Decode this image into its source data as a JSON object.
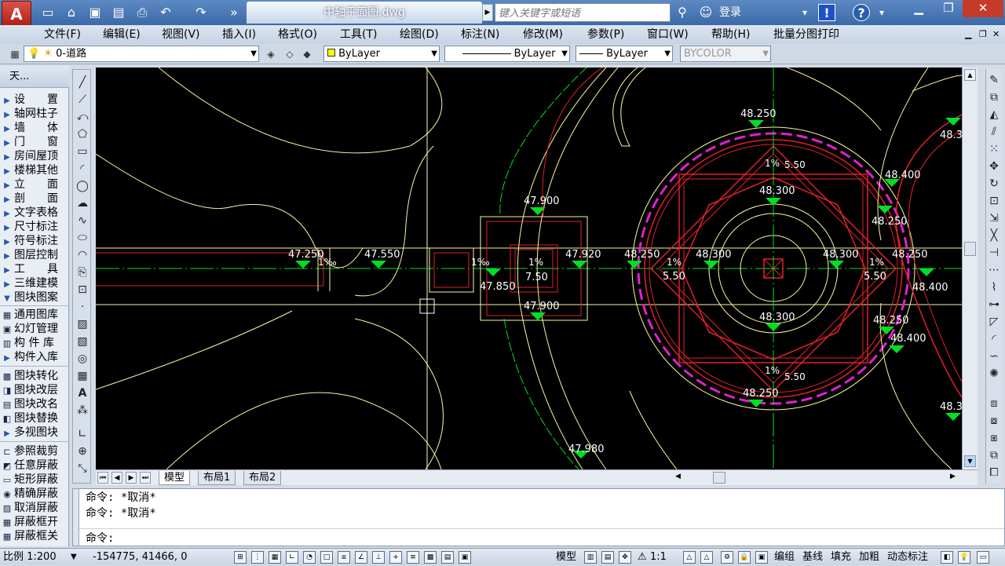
{
  "titlebar": {
    "app_button_label": "A",
    "document_title": "中轴平面图.dwg",
    "search_placeholder": "键入关键字或短语",
    "login_label": "登录"
  },
  "menu": {
    "items": [
      "文件(F)",
      "编辑(E)",
      "视图(V)",
      "插入(I)",
      "格式(O)",
      "工具(T)",
      "绘图(D)",
      "标注(N)",
      "修改(M)",
      "参数(P)",
      "窗口(W)",
      "帮助(H)",
      "批量分图打印"
    ]
  },
  "toolbar": {
    "layer_value": "0-道路",
    "color_value": "ByLayer",
    "linetype_value": "ByLayer",
    "lineweight_value": "ByLayer",
    "plotstyle_value": "BYCOLOR"
  },
  "left_panel": {
    "header": "天...",
    "items": [
      "设　　置",
      "轴网柱子",
      "墙　　体",
      "门　　窗",
      "房间屋顶",
      "楼梯其他",
      "立　　面",
      "剖　　面",
      "文字表格",
      "尺寸标注",
      "符号标注",
      "图层控制",
      "工　　具",
      "三维建模",
      "图块图案"
    ],
    "lib_items": [
      "通用图库",
      "幻灯管理",
      "构 件 库",
      "构件入库"
    ],
    "block_items": [
      "图块转化",
      "图块改层",
      "图块改名",
      "图块替换",
      "多视图块"
    ],
    "mask_items": [
      "参照裁剪",
      "任意屏蔽",
      "矩形屏蔽",
      "精确屏蔽",
      "取消屏蔽",
      "屏蔽框开",
      "屏蔽框关"
    ]
  },
  "drawing": {
    "elevations": {
      "e47250": "47.250",
      "e47550": "47.550",
      "e47900_top": "47.900",
      "e47920": "47.920",
      "e47850": "47.850",
      "e47900_bot": "47.900",
      "e47980": "47.980",
      "e48250_left": "48.250",
      "e48300_left": "48.300",
      "e48300_top": "48.300",
      "e48300_right": "48.300",
      "e48300_bot": "48.300",
      "e48250_top": "48.250",
      "e48250_bot": "48.250",
      "e48400_tr": "48.400",
      "e48250_tr2": "48.250",
      "e48250_right": "48.250",
      "e48400_right": "48.400",
      "e48250_br": "48.250",
      "e48400_br": "48.400",
      "e483_edge1": "48.3",
      "e483_edge2": "48.3"
    },
    "slopes": {
      "s_left1": "1‰",
      "s_left2": "1‰",
      "s_center": "1%",
      "s_left_circle": "1%",
      "s_right_circle": "1%",
      "s_vert_top": "1%",
      "s_vert_bot": "1%"
    },
    "dims": {
      "d750": "7.50",
      "d550_left": "5.50",
      "d550_right": "5.50",
      "d550_top": "5.50",
      "d550_bot": "5.50"
    }
  },
  "tabs": [
    "模型",
    "布局1",
    "布局2"
  ],
  "command": {
    "history": [
      "命令: *取消*",
      "命令: *取消*"
    ],
    "prompt": "命令:"
  },
  "status": {
    "scale": "比例 1:200",
    "coords": "-154775, 41466, 0",
    "model_label": "模型",
    "annotation_scale": "1:1",
    "buttons": [
      "编组",
      "基线",
      "填充",
      "加粗",
      "动态标注"
    ]
  },
  "colors": {
    "canvas_bg": "#000000",
    "red": "#e0202a",
    "magenta": "#e020d0",
    "green": "#00e020",
    "yellow": "#ffff80"
  }
}
